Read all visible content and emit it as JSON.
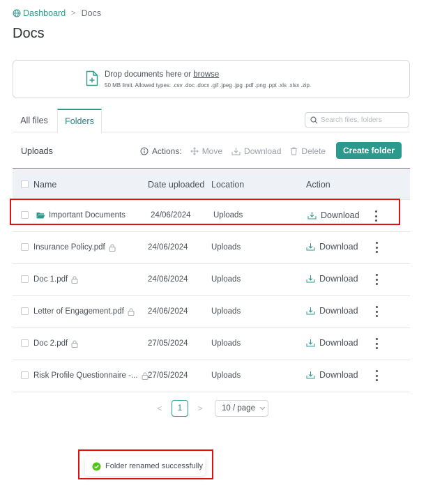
{
  "breadcrumb": {
    "home": "Dashboard",
    "separator": ">",
    "current": "Docs"
  },
  "page_title": "Docs",
  "dropzone": {
    "prompt": "Drop documents here or ",
    "link": "browse",
    "limits": "50 MB limit. Allowed types: .csv .doc .docx .gif .jpeg .jpg .pdf .png .ppt .xls .xlsx .zip."
  },
  "tabs": [
    {
      "label": "All files",
      "active": false
    },
    {
      "label": "Folders",
      "active": true
    }
  ],
  "search": {
    "placeholder": "Search files, folders",
    "value": ""
  },
  "toolbar": {
    "section": "Uploads",
    "actions_label": "Actions:",
    "move": "Move",
    "download": "Download",
    "delete": "Delete",
    "create_folder": "Create folder"
  },
  "columns": {
    "name": "Name",
    "date": "Date uploaded",
    "location": "Location",
    "action": "Action"
  },
  "rows": [
    {
      "name": "Important Documents",
      "type": "folder",
      "locked": false,
      "date": "24/06/2024",
      "location": "Uploads",
      "action": "Download",
      "highlighted": true
    },
    {
      "name": "Insurance Policy.pdf",
      "type": "file",
      "locked": true,
      "date": "24/06/2024",
      "location": "Uploads",
      "action": "Download",
      "highlighted": false
    },
    {
      "name": "Doc 1.pdf",
      "type": "file",
      "locked": true,
      "date": "24/06/2024",
      "location": "Uploads",
      "action": "Download",
      "highlighted": false
    },
    {
      "name": "Letter of Engagement.pdf",
      "type": "file",
      "locked": true,
      "date": "24/06/2024",
      "location": "Uploads",
      "action": "Download",
      "highlighted": false
    },
    {
      "name": "Doc 2.pdf",
      "type": "file",
      "locked": true,
      "date": "27/05/2024",
      "location": "Uploads",
      "action": "Download",
      "highlighted": false
    },
    {
      "name": "Risk Profile Questionnaire -...",
      "type": "file",
      "locked": true,
      "date": "27/05/2024",
      "location": "Uploads",
      "action": "Download",
      "highlighted": false
    }
  ],
  "pagination": {
    "prev": "<",
    "current_page": "1",
    "next": ">",
    "page_size": "10 / page"
  },
  "toast": {
    "message": "Folder renamed successfully",
    "highlighted": true
  },
  "colors": {
    "accent": "#2b9a8d",
    "folder": "#2b9a8d",
    "highlight": "#e01010",
    "success": "#52c41a"
  }
}
